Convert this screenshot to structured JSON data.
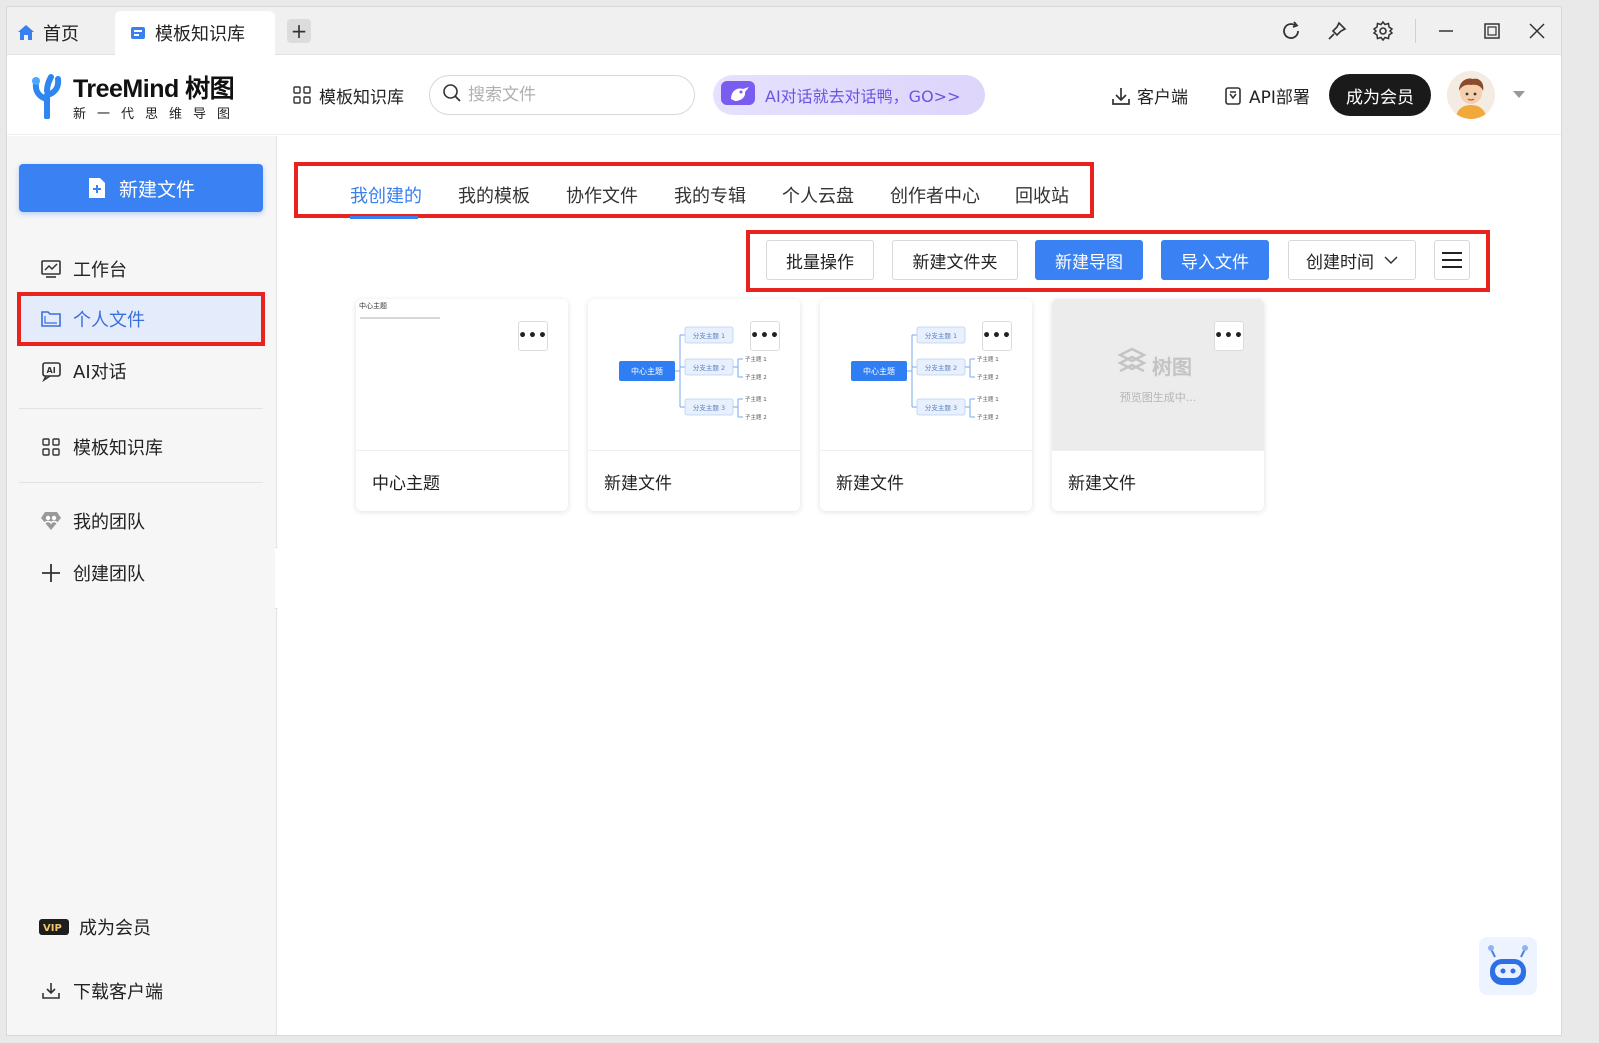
{
  "titlebar": {
    "tabs": [
      {
        "label": "首页"
      },
      {
        "label": "模板知识库"
      }
    ]
  },
  "header": {
    "logo_title": "TreeMind 树图",
    "logo_subtitle": "新一代思维导图",
    "template_link": "模板知识库",
    "search_placeholder": "搜索文件",
    "ai_banner": "AI对话就去对话鸭，GO>>",
    "client_link": "客户端",
    "api_link": "API部署",
    "vip_button": "成为会员"
  },
  "sidebar": {
    "new_file": "新建文件",
    "items": [
      {
        "label": "工作台"
      },
      {
        "label": "个人文件"
      },
      {
        "label": "AI对话"
      },
      {
        "label": "模板知识库"
      },
      {
        "label": "我的团队"
      },
      {
        "label": "创建团队"
      }
    ],
    "footer": [
      {
        "label": "成为会员",
        "badge": "VIP"
      },
      {
        "label": "下载客户端"
      }
    ]
  },
  "main": {
    "tabs": [
      {
        "label": "我创建的"
      },
      {
        "label": "我的模板"
      },
      {
        "label": "协作文件"
      },
      {
        "label": "我的专辑"
      },
      {
        "label": "个人云盘"
      },
      {
        "label": "创作者中心"
      },
      {
        "label": "回收站"
      }
    ],
    "toolbar": {
      "batch": "批量操作",
      "new_folder": "新建文件夹",
      "new_map": "新建导图",
      "import": "导入文件",
      "sort": "创建时间"
    },
    "cards": [
      {
        "name": "中心主题",
        "thumb_title": "中心主题"
      },
      {
        "name": "新建文件",
        "center": "中心主题",
        "branches": [
          "分支主题 1",
          "分支主题 2",
          "分支主题 3"
        ],
        "leaves": [
          "子主题 1",
          "子主题 2",
          "子主题 1",
          "子主题 2"
        ]
      },
      {
        "name": "新建文件",
        "center": "中心主题",
        "branches": [
          "分支主题 1",
          "分支主题 2",
          "分支主题 3"
        ],
        "leaves": [
          "子主题 1",
          "子主题 2",
          "子主题 1",
          "子主题 2"
        ]
      },
      {
        "name": "新建文件",
        "placeholder_logo": "树图",
        "placeholder_text": "预览图生成中..."
      }
    ]
  },
  "colors": {
    "accent": "#3a82f4",
    "highlight_box": "#e8231e",
    "vip_button": "#1a1a1a"
  }
}
